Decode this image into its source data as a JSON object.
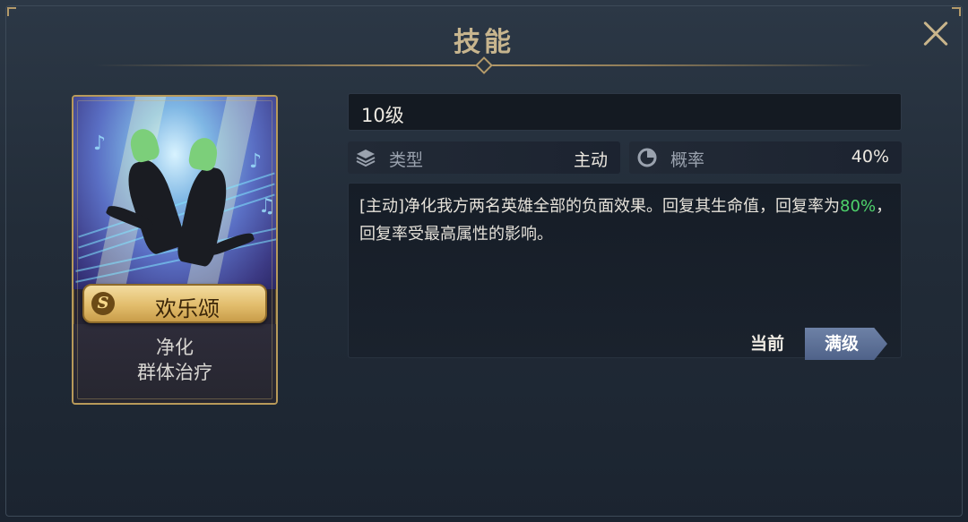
{
  "header": {
    "title": "技能"
  },
  "card": {
    "rank": "S",
    "name": "欢乐颂",
    "tags": [
      "净化",
      "群体治疗"
    ]
  },
  "skill": {
    "level": "10级",
    "type_label": "类型",
    "type_value": "主动",
    "chance_label": "概率",
    "chance_value": "40%",
    "description_part1": "[主动]净化我方两名英雄全部的负面效果。回复其生命值，回复率为",
    "description_highlight": "80%",
    "description_part2": "，回复率受最高属性的影响。"
  },
  "buttons": {
    "current": "当前",
    "max": "满级"
  },
  "colors": {
    "gold": "#b49a6a",
    "highlight_green": "#4ed36b",
    "active_tab": "#5b6e96"
  },
  "icons": {
    "close": "close-icon",
    "type": "layers-icon",
    "chance": "pie-chart-icon",
    "rank": "rank-s-icon"
  }
}
